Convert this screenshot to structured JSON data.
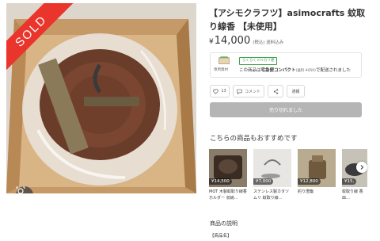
{
  "image": {
    "sold_label": "SOLD"
  },
  "product": {
    "title": "【アシモクラフツ】asimocrafts 蚊取り線香 【未使用】",
    "currency": "¥",
    "price": "14,000",
    "tax_note": "(税込) 送料込み"
  },
  "shipping": {
    "icon_label": "専用資材",
    "badge": "らくらくメルカリ便",
    "text_prefix": "この商品は",
    "method": "宅急便コンパクト",
    "fee": "(送料 ¥450)",
    "text_suffix": "で配送されました"
  },
  "actions": {
    "like_count": "13",
    "comment_label": "コメント",
    "report_label": "通報"
  },
  "sold_button": "売り切れました",
  "recommend": {
    "title": "こちらの商品もおすすめです",
    "items": [
      {
        "price": "¥14,500",
        "name": "MOT 木製蚊取り線香ホルダー 収納…"
      },
      {
        "price": "¥7,000",
        "name": "ステンレス製カタツムリ 蚊取り線…"
      },
      {
        "price": "¥12,800",
        "name": "釣り燈籠"
      },
      {
        "price": "¥15,",
        "name": "蚊取り線 香皿…"
      }
    ]
  },
  "description": {
    "title": "商品の説明",
    "first_line": "【商品名】"
  },
  "colors": {
    "sold_red": "#ea352d",
    "green": "#3da34a",
    "sold_btn": "#b5b5b5"
  }
}
